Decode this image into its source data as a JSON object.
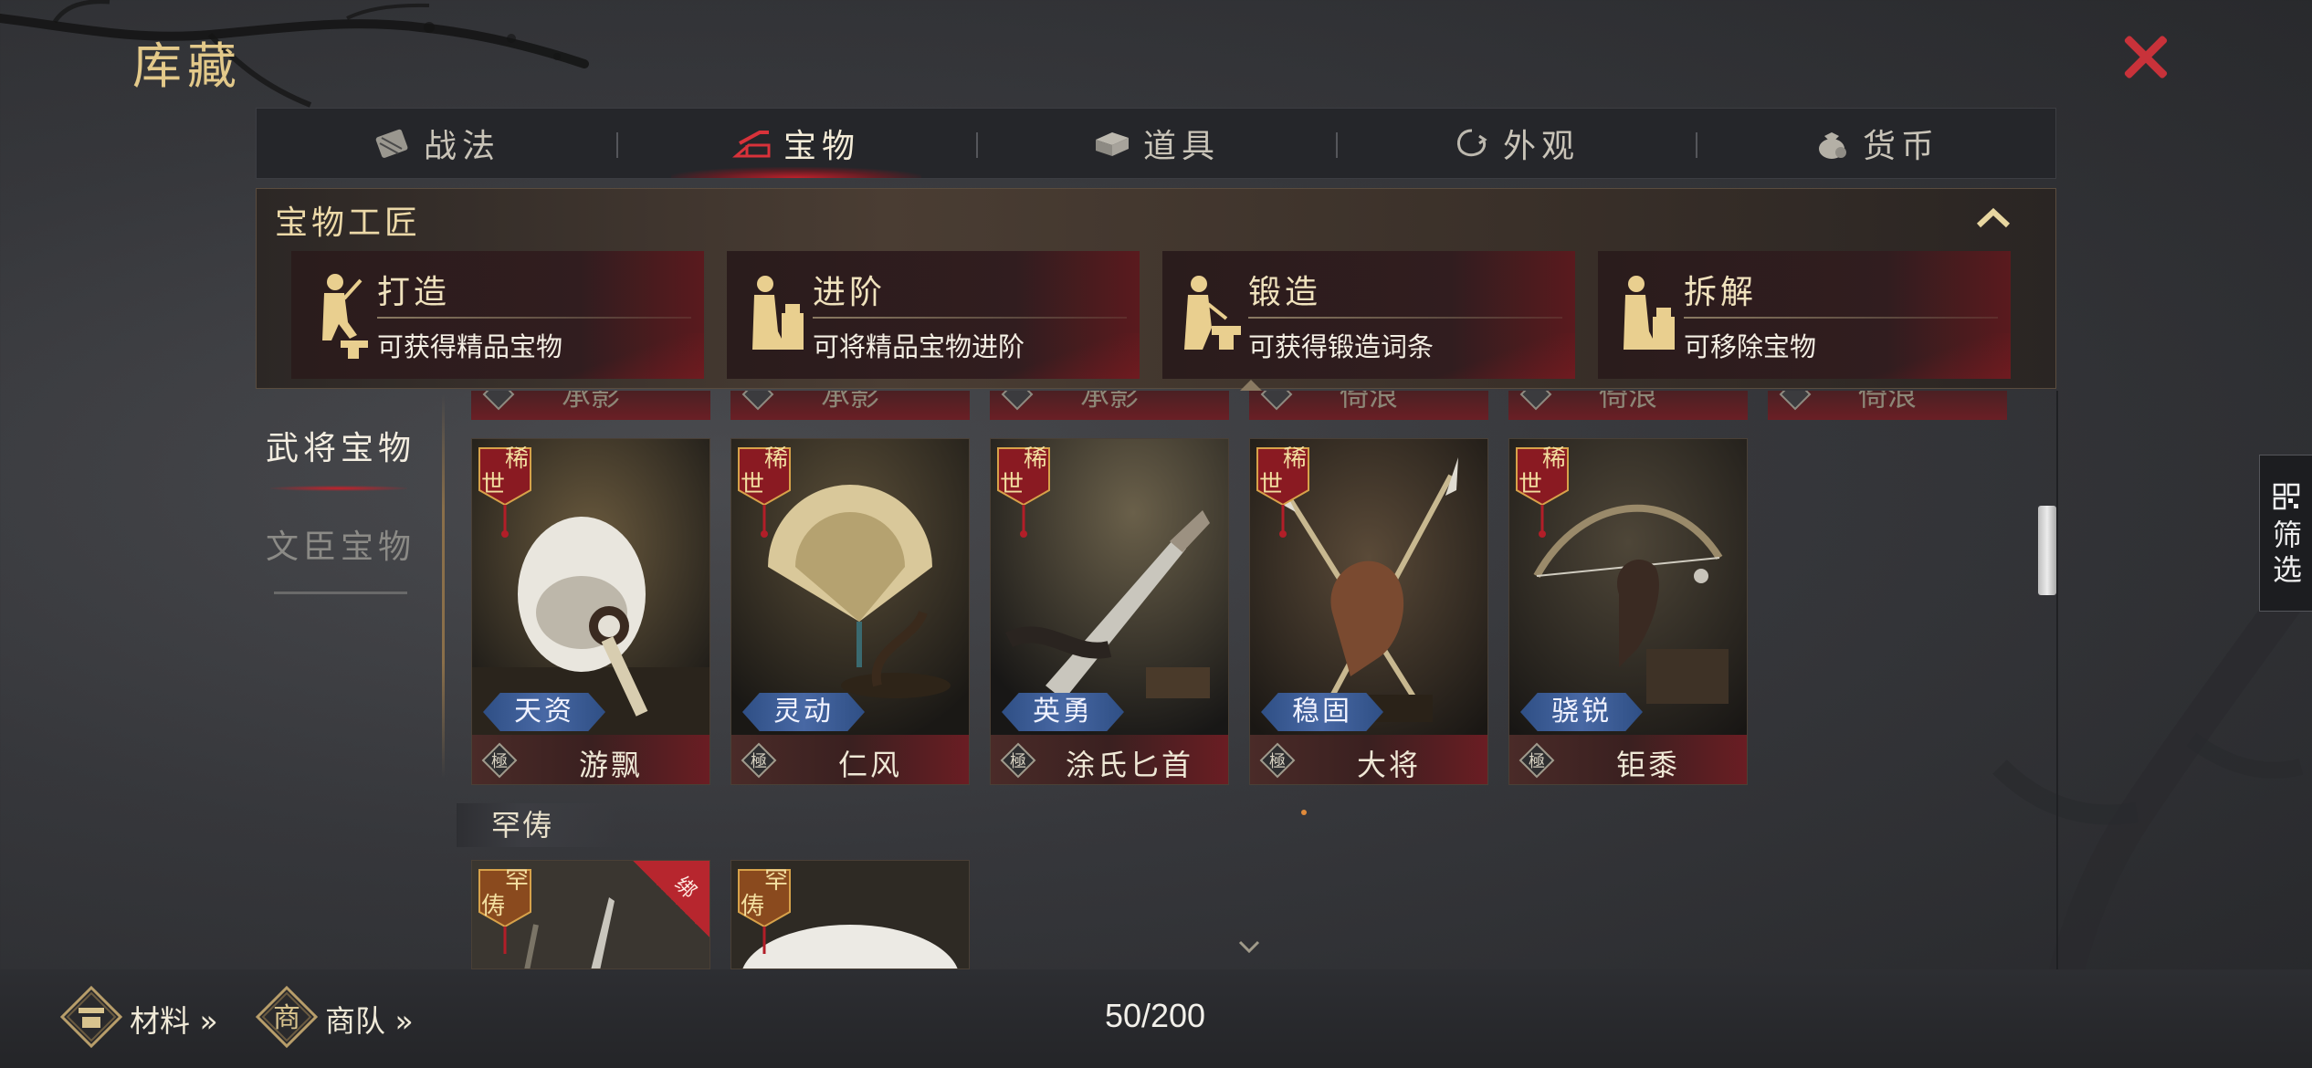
{
  "header": {
    "title": "库藏",
    "close_icon": "close-icon",
    "accent_color": "#c8323a"
  },
  "tabs": [
    {
      "label": "战法",
      "icon": "scroll-icon",
      "active": false
    },
    {
      "label": "宝物",
      "icon": "treasure-icon",
      "active": true
    },
    {
      "label": "道具",
      "icon": "item-box-icon",
      "active": false
    },
    {
      "label": "外观",
      "icon": "appearance-icon",
      "active": false
    },
    {
      "label": "货币",
      "icon": "money-bag-icon",
      "active": false
    }
  ],
  "craft_panel": {
    "title": "宝物工匠",
    "collapse_icon": "chevron-up-icon",
    "actions": [
      {
        "name": "打造",
        "desc": "可获得精品宝物"
      },
      {
        "name": "进阶",
        "desc": "可将精品宝物进阶"
      },
      {
        "name": "锻造",
        "desc": "可获得锻造词条"
      },
      {
        "name": "拆解",
        "desc": "可移除宝物"
      }
    ]
  },
  "categories": [
    {
      "label": "武将宝物",
      "active": true
    },
    {
      "label": "文臣宝物",
      "active": false
    }
  ],
  "partial_row": {
    "badge": "極",
    "names": [
      "承影",
      "承影",
      "承影",
      "倚浪",
      "倚浪",
      "倚浪"
    ]
  },
  "rare_items": [
    {
      "rarity": "稀世",
      "trait": "天资",
      "badge": "極",
      "name": "游飘"
    },
    {
      "rarity": "稀世",
      "trait": "灵动",
      "badge": "極",
      "name": "仁风"
    },
    {
      "rarity": "稀世",
      "trait": "英勇",
      "badge": "極",
      "name": "涂氏匕首"
    },
    {
      "rarity": "稀世",
      "trait": "稳固",
      "badge": "極",
      "name": "大将"
    },
    {
      "rarity": "稀世",
      "trait": "骁锐",
      "badge": "極",
      "name": "钜黍"
    }
  ],
  "section_hanchou": {
    "label": "罕俦",
    "items": [
      {
        "rarity": "罕俦",
        "bound_tag": "绑"
      },
      {
        "rarity": "罕俦"
      }
    ]
  },
  "filter": {
    "label_1": "筛",
    "label_2": "选",
    "icon": "grid-filter-icon"
  },
  "bottom": {
    "materials_icon": "scale-icon",
    "materials_label": "材料 »",
    "caravan_icon_char": "商",
    "caravan_label": "商队 »",
    "capacity": "50/200"
  }
}
